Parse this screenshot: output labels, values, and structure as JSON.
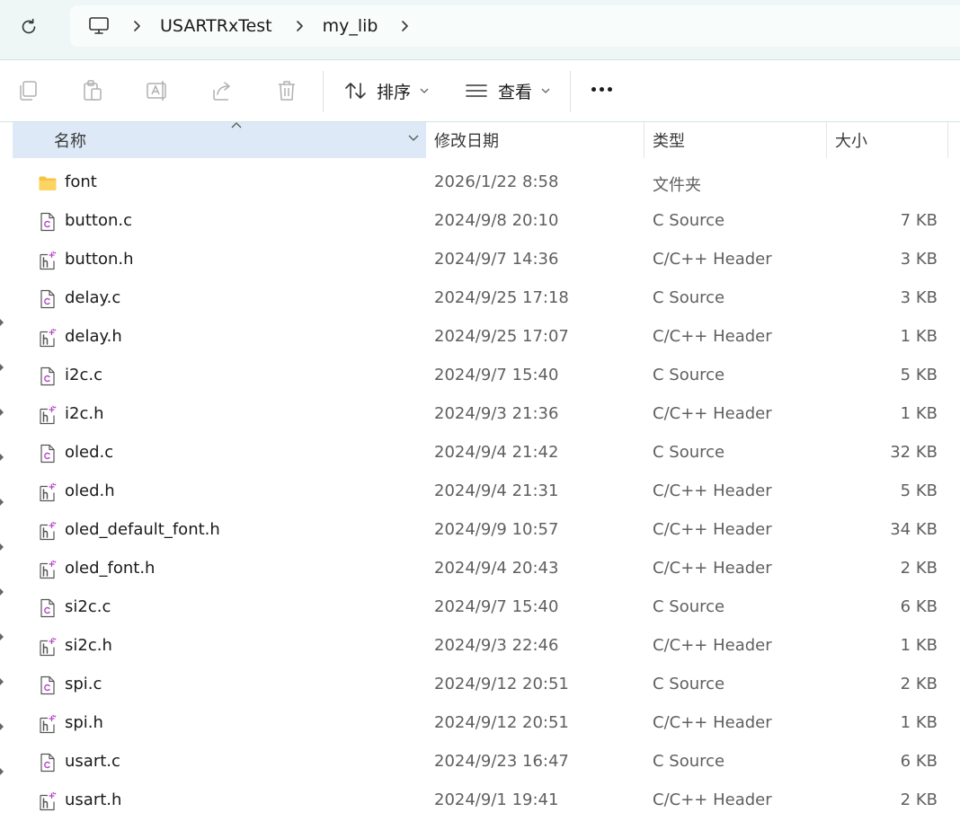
{
  "breadcrumb": {
    "items": [
      "USARTRxTest",
      "my_lib"
    ]
  },
  "toolbar": {
    "sort_label": "排序",
    "view_label": "查看"
  },
  "columns": {
    "name": "名称",
    "date": "修改日期",
    "type": "类型",
    "size": "大小"
  },
  "colors": {
    "accent": "#dde9f6",
    "folder": "#f6c344",
    "header_icon_accent": "#b548c6"
  },
  "files": [
    {
      "name": "font",
      "date": "2026/1/22 8:58",
      "type": "文件夹",
      "size": "",
      "icon": "folder-icon"
    },
    {
      "name": "button.c",
      "date": "2024/9/8 20:10",
      "type": "C Source",
      "size": "7 KB",
      "icon": "c-source-file-icon"
    },
    {
      "name": "button.h",
      "date": "2024/9/7 14:36",
      "type": "C/C++ Header",
      "size": "3 KB",
      "icon": "header-file-icon"
    },
    {
      "name": "delay.c",
      "date": "2024/9/25 17:18",
      "type": "C Source",
      "size": "3 KB",
      "icon": "c-source-file-icon"
    },
    {
      "name": "delay.h",
      "date": "2024/9/25 17:07",
      "type": "C/C++ Header",
      "size": "1 KB",
      "icon": "header-file-icon"
    },
    {
      "name": "i2c.c",
      "date": "2024/9/7 15:40",
      "type": "C Source",
      "size": "5 KB",
      "icon": "c-source-file-icon"
    },
    {
      "name": "i2c.h",
      "date": "2024/9/3 21:36",
      "type": "C/C++ Header",
      "size": "1 KB",
      "icon": "header-file-icon"
    },
    {
      "name": "oled.c",
      "date": "2024/9/4 21:42",
      "type": "C Source",
      "size": "32 KB",
      "icon": "c-source-file-icon"
    },
    {
      "name": "oled.h",
      "date": "2024/9/4 21:31",
      "type": "C/C++ Header",
      "size": "5 KB",
      "icon": "header-file-icon"
    },
    {
      "name": "oled_default_font.h",
      "date": "2024/9/9 10:57",
      "type": "C/C++ Header",
      "size": "34 KB",
      "icon": "header-file-icon"
    },
    {
      "name": "oled_font.h",
      "date": "2024/9/4 20:43",
      "type": "C/C++ Header",
      "size": "2 KB",
      "icon": "header-file-icon"
    },
    {
      "name": "si2c.c",
      "date": "2024/9/7 15:40",
      "type": "C Source",
      "size": "6 KB",
      "icon": "c-source-file-icon"
    },
    {
      "name": "si2c.h",
      "date": "2024/9/3 22:46",
      "type": "C/C++ Header",
      "size": "1 KB",
      "icon": "header-file-icon"
    },
    {
      "name": "spi.c",
      "date": "2024/9/12 20:51",
      "type": "C Source",
      "size": "2 KB",
      "icon": "c-source-file-icon"
    },
    {
      "name": "spi.h",
      "date": "2024/9/12 20:51",
      "type": "C/C++ Header",
      "size": "1 KB",
      "icon": "header-file-icon"
    },
    {
      "name": "usart.c",
      "date": "2024/9/23 16:47",
      "type": "C Source",
      "size": "6 KB",
      "icon": "c-source-file-icon"
    },
    {
      "name": "usart.h",
      "date": "2024/9/1 19:41",
      "type": "C/C++ Header",
      "size": "2 KB",
      "icon": "header-file-icon"
    }
  ]
}
